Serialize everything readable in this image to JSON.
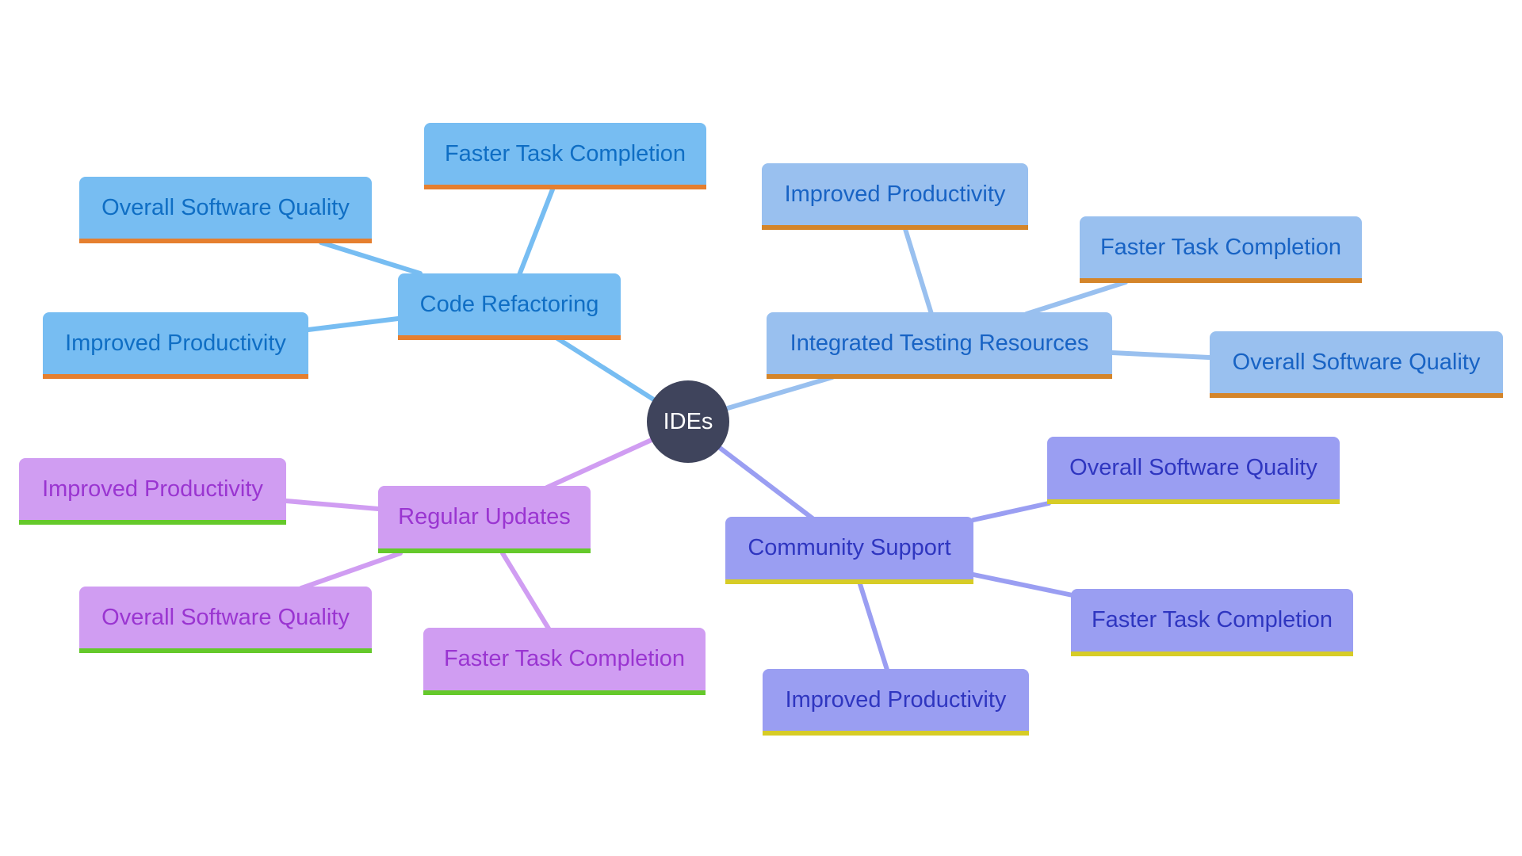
{
  "diagram": {
    "type": "mind-map",
    "root": {
      "label": "IDEs",
      "color": "#3f445c"
    },
    "branches": [
      {
        "id": "cr",
        "label": "Code Refactoring",
        "fill": "#77bdf2",
        "text": "#0f6ec4",
        "accent": "#e57f2f",
        "line": "#77bdf2",
        "children": [
          "Faster Task Completion",
          "Overall Software Quality",
          "Improved Productivity"
        ]
      },
      {
        "id": "it",
        "label": "Integrated Testing Resources",
        "fill": "#99c0ef",
        "text": "#1863c4",
        "accent": "#d4852a",
        "line": "#99c0ef",
        "children": [
          "Improved Productivity",
          "Faster Task Completion",
          "Overall Software Quality"
        ]
      },
      {
        "id": "cs",
        "label": "Community Support",
        "fill": "#9a9ef2",
        "text": "#2f36c0",
        "accent": "#d7cc26",
        "line": "#9a9ef2",
        "children": [
          "Overall Software Quality",
          "Faster Task Completion",
          "Improved Productivity"
        ]
      },
      {
        "id": "ru",
        "label": "Regular Updates",
        "fill": "#d09df2",
        "text": "#9a35d1",
        "accent": "#65c92b",
        "line": "#d09df2",
        "children": [
          "Improved Productivity",
          "Overall Software Quality",
          "Faster Task Completion"
        ]
      }
    ]
  }
}
